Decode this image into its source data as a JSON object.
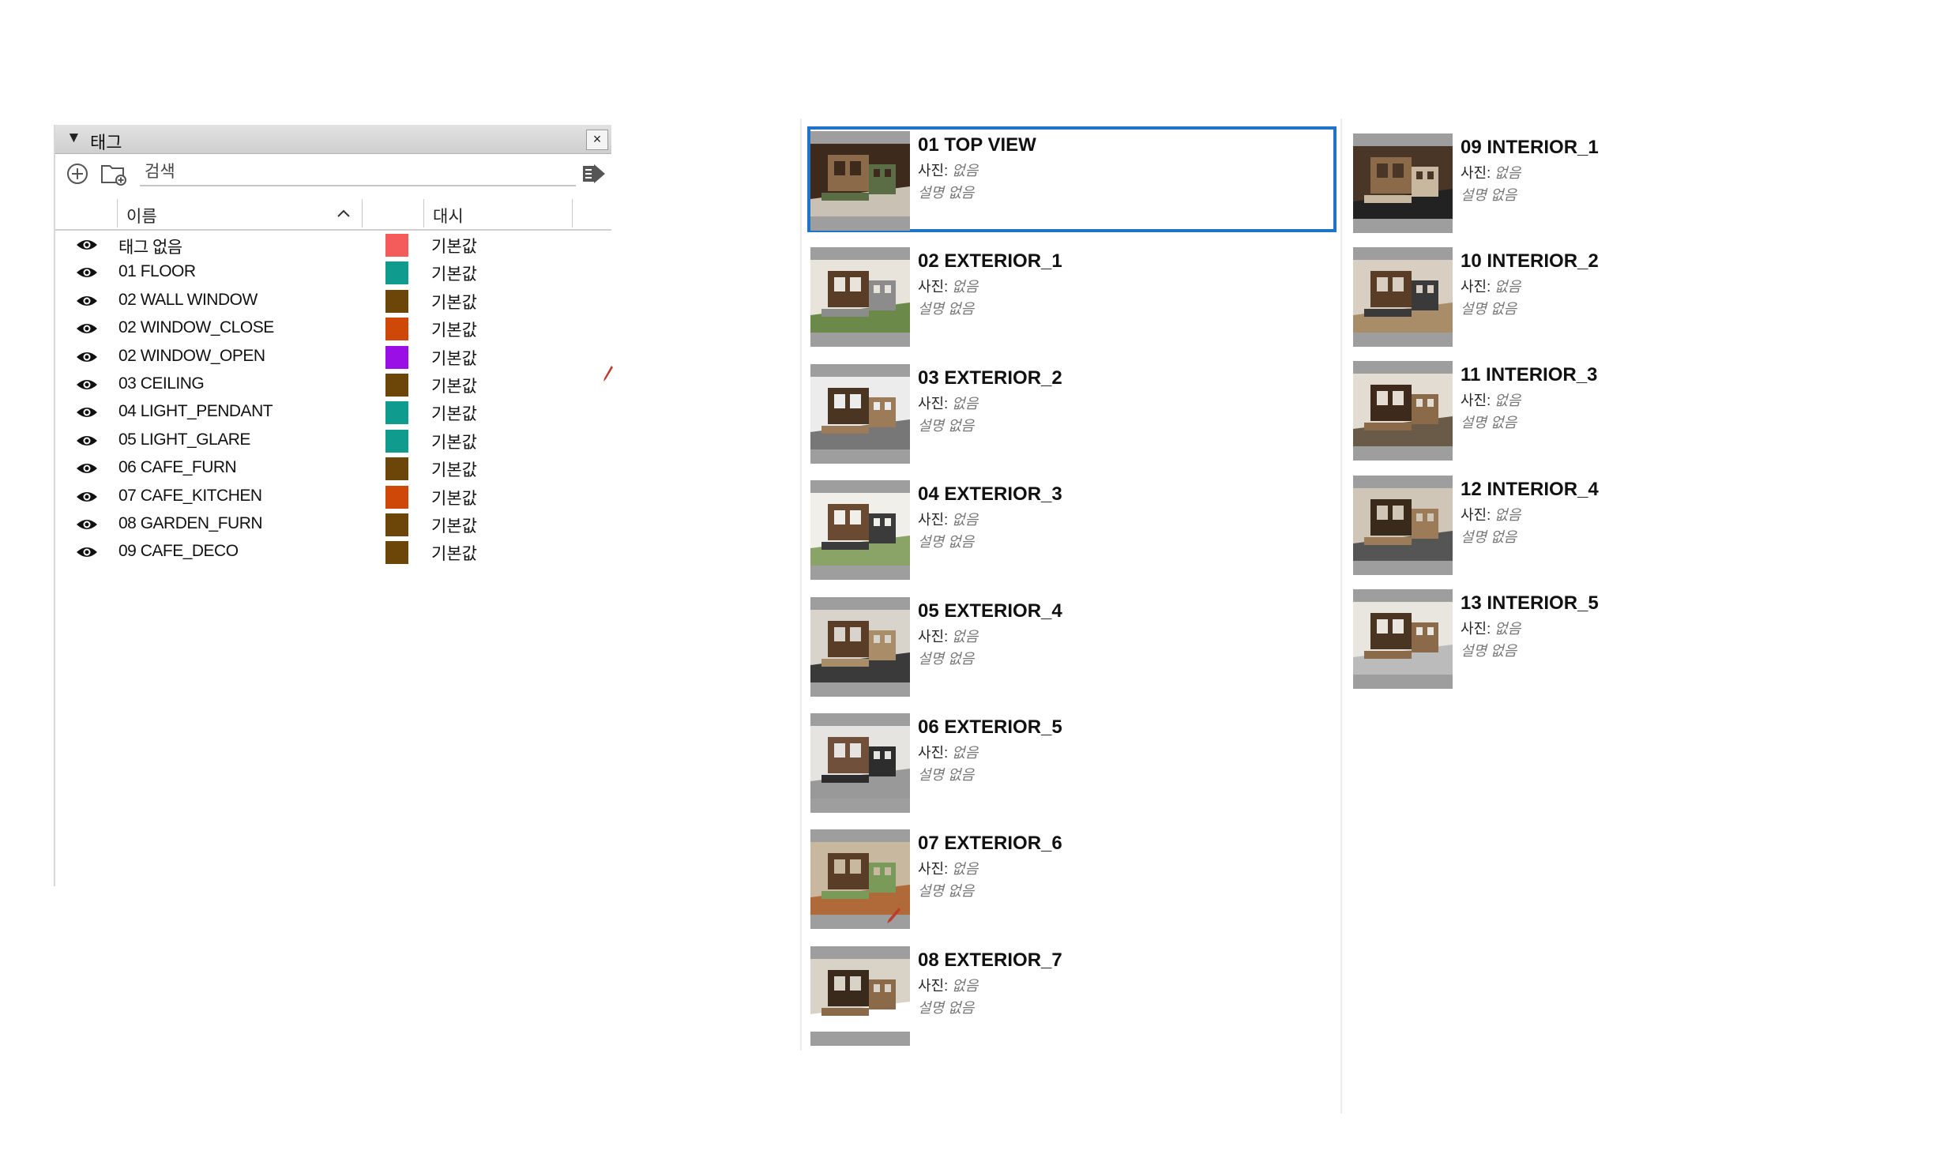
{
  "tags_panel": {
    "title": "태그",
    "collapse_glyph": "▼",
    "close_glyph": "×",
    "search_placeholder": "검색",
    "columns": {
      "name": "이름",
      "dash": "대시"
    },
    "tags": [
      {
        "name": "태그 없음",
        "color": "#f45b5b",
        "dash": "기본값"
      },
      {
        "name": "01 FLOOR",
        "color": "#0f9b8e",
        "dash": "기본값"
      },
      {
        "name": "02 WALL WINDOW",
        "color": "#6b4608",
        "dash": "기본값"
      },
      {
        "name": "02 WINDOW_CLOSE",
        "color": "#cf4808",
        "dash": "기본값"
      },
      {
        "name": "02 WINDOW_OPEN",
        "color": "#9a0fe6",
        "dash": "기본값"
      },
      {
        "name": "03 CEILING",
        "color": "#6b4608",
        "dash": "기본값"
      },
      {
        "name": "04 LIGHT_PENDANT",
        "color": "#0f9b8e",
        "dash": "기본값"
      },
      {
        "name": "05 LIGHT_GLARE",
        "color": "#0f9b8e",
        "dash": "기본값"
      },
      {
        "name": "06 CAFE_FURN",
        "color": "#6b4608",
        "dash": "기본값"
      },
      {
        "name": "07 CAFE_KITCHEN",
        "color": "#cf4808",
        "dash": "기본값"
      },
      {
        "name": "08 GARDEN_FURN",
        "color": "#6b4608",
        "dash": "기본값"
      },
      {
        "name": "09 CAFE_DECO",
        "color": "#6b4608",
        "dash": "기본값"
      }
    ]
  },
  "scenes": {
    "photo_label": "사진:",
    "photo_value": "없음",
    "desc_text": "설명 없음",
    "selected_color": "#1f74c8",
    "items": [
      {
        "title": "01 TOP VIEW",
        "selected": true
      },
      {
        "title": "02 EXTERIOR_1"
      },
      {
        "title": "03 EXTERIOR_2"
      },
      {
        "title": "04 EXTERIOR_3"
      },
      {
        "title": "05 EXTERIOR_4"
      },
      {
        "title": "06 EXTERIOR_5"
      },
      {
        "title": "07 EXTERIOR_6"
      },
      {
        "title": "08 EXTERIOR_7"
      },
      {
        "title": "09 INTERIOR_1"
      },
      {
        "title": "10 INTERIOR_2"
      },
      {
        "title": "11 INTERIOR_3"
      },
      {
        "title": "12 INTERIOR_4"
      },
      {
        "title": "13 INTERIOR_5"
      }
    ]
  }
}
